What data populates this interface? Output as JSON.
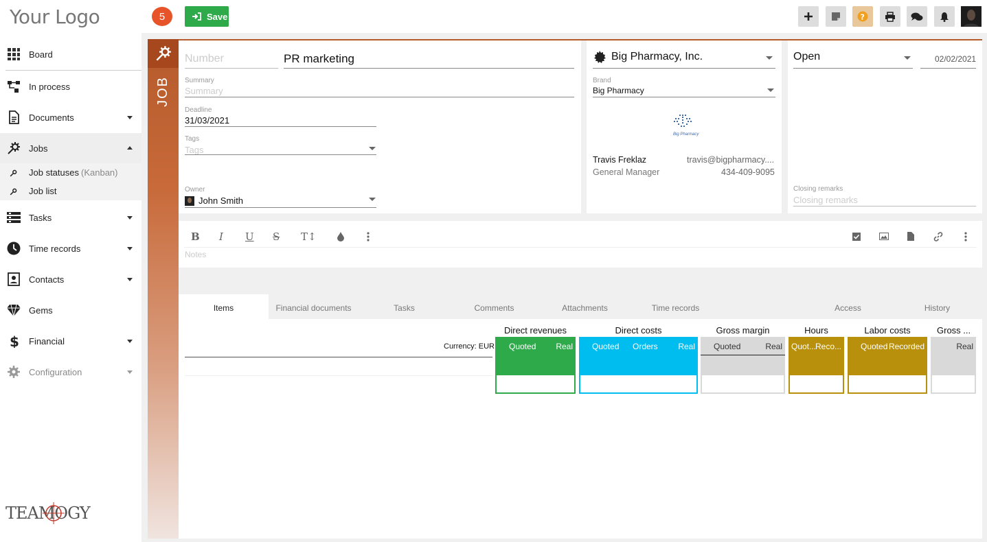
{
  "app": {
    "logo_text": "Your Logo",
    "brand_text": "TEAMOGY"
  },
  "sidebar": {
    "items": [
      {
        "label": "Board"
      },
      {
        "label": "In process"
      },
      {
        "label": "Documents"
      },
      {
        "label": "Jobs"
      },
      {
        "label": "Tasks"
      },
      {
        "label": "Time records"
      },
      {
        "label": "Contacts"
      },
      {
        "label": "Gems"
      },
      {
        "label": "Financial"
      },
      {
        "label": "Configuration"
      }
    ],
    "jobs_sub": [
      {
        "label": "Job statuses",
        "suffix": "(Kanban)"
      },
      {
        "label": "Job list"
      }
    ]
  },
  "toolbar": {
    "badge_count": "5",
    "save_label": "Save"
  },
  "job": {
    "strip_label": "JOB",
    "number_placeholder": "Number",
    "title": "PR marketing",
    "summary_label": "Summary",
    "summary_placeholder": "Summary",
    "deadline_label": "Deadline",
    "deadline": "31/03/2021",
    "tags_label": "Tags",
    "tags_placeholder": "Tags",
    "owner_label": "Owner",
    "owner": "John Smith"
  },
  "client": {
    "company": "Big Pharmacy, Inc.",
    "brand_label": "Brand",
    "brand": "Big Pharmacy",
    "brand_logo_text": "Big Pharmacy",
    "contact_name": "Travis Freklaz",
    "contact_email": "travis@bigpharmacy....",
    "contact_role": "General Manager",
    "contact_phone": "434-409-9095"
  },
  "status": {
    "value": "Open",
    "date": "02/02/2021",
    "closing_label": "Closing remarks",
    "closing_placeholder": "Closing remarks"
  },
  "editor": {
    "notes_placeholder": "Notes"
  },
  "tabs": [
    {
      "label": "Items"
    },
    {
      "label": "Financial documents"
    },
    {
      "label": "Tasks"
    },
    {
      "label": "Comments"
    },
    {
      "label": "Attachments"
    },
    {
      "label": "Time records"
    },
    {
      "label": ""
    },
    {
      "label": "Access"
    },
    {
      "label": "History"
    }
  ],
  "items_table": {
    "currency": "Currency: EUR",
    "groups": [
      {
        "title": "Direct revenues",
        "cols": [
          "Quoted",
          "Real"
        ],
        "color": "#2eaa4a"
      },
      {
        "title": "Direct costs",
        "cols": [
          "Quoted",
          "Orders",
          "Real"
        ],
        "color": "#00bdf0"
      },
      {
        "title": "Gross margin",
        "cols": [
          "Quoted",
          "Real"
        ],
        "color": "#d9d9d9"
      },
      {
        "title": "Hours",
        "cols": [
          "Quot...",
          "Reco..."
        ],
        "color": "#b8900c"
      },
      {
        "title": "Labor costs",
        "cols": [
          "Quoted",
          "Recorded"
        ],
        "color": "#b8900c"
      },
      {
        "title": "Gross ...",
        "cols": [
          "Real"
        ],
        "color": "#d9d9d9"
      }
    ]
  }
}
